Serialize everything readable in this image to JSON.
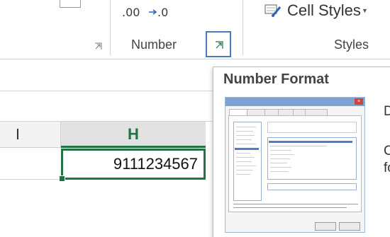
{
  "ribbon": {
    "number_group": {
      "label": "Number",
      "increase_decimal_text": ".00",
      "decrease_decimal_text": ".0"
    },
    "styles_group": {
      "label": "Styles",
      "cell_styles_label": "Cell Styles"
    }
  },
  "sheet": {
    "column_i_label": "I",
    "column_h_label": "H",
    "active_cell_value": "9111234567"
  },
  "tooltip": {
    "title": "Number Format",
    "desc_fragment_1": "D",
    "desc_fragment_2": "C",
    "desc_fragment_3": "fo"
  },
  "colors": {
    "excel_green": "#217346",
    "launcher_highlight": "#4a79b8"
  }
}
